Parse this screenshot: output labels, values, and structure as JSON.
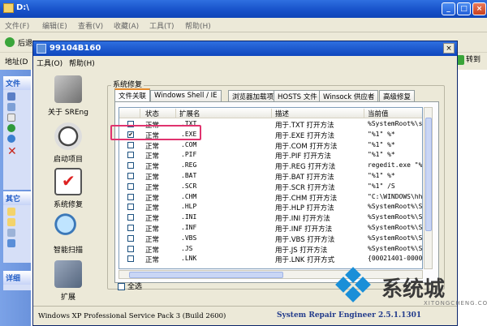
{
  "explorer": {
    "title": "D:\\",
    "menu": [
      "文件(F)",
      "编辑(E)",
      "查看(V)",
      "收藏(A)",
      "工具(T)",
      "帮助(H)"
    ],
    "back_label": "后退",
    "address_label": "地址(D",
    "go_label": "转到",
    "left_panel_headers": [
      "文件",
      "其它",
      "详细"
    ]
  },
  "dialog": {
    "title": "99104B160",
    "close": "×",
    "menu": [
      "工具(O)",
      "帮助(H)"
    ],
    "nav": [
      {
        "label": "关于 SREng",
        "icon": "tools-icon"
      },
      {
        "label": "启动项目",
        "icon": "clock-icon"
      },
      {
        "label": "系统修复",
        "icon": "checklist-icon"
      },
      {
        "label": "智能扫描",
        "icon": "magnifier-icon"
      },
      {
        "label": "扩展",
        "icon": "puzzle-plus-icon"
      }
    ],
    "group_label": "系统修复",
    "tabs": [
      "文件关联",
      "Windows Shell / IE",
      "浏览器加载项",
      "HOSTS 文件",
      "Winsock 供应者",
      "高级修复"
    ],
    "active_tab": 0,
    "columns": [
      "状态",
      "扩展名",
      "描述",
      "当前值"
    ],
    "rows": [
      {
        "checked": false,
        "status": "正常",
        "ext": ".TXT",
        "desc": "用于.TXT 打开方法",
        "value": "%SystemRoot%\\system32\\"
      },
      {
        "checked": true,
        "status": "正常",
        "ext": ".EXE",
        "desc": "用于.EXE 打开方法",
        "value": "\"%1\" %*"
      },
      {
        "checked": false,
        "status": "正常",
        "ext": ".COM",
        "desc": "用于.COM 打开方法",
        "value": "\"%1\" %*"
      },
      {
        "checked": false,
        "status": "正常",
        "ext": ".PIF",
        "desc": "用于.PIF 打开方法",
        "value": "\"%1\" %*"
      },
      {
        "checked": false,
        "status": "正常",
        "ext": ".REG",
        "desc": "用于.REG 打开方法",
        "value": "regedit.exe \"%1\""
      },
      {
        "checked": false,
        "status": "正常",
        "ext": ".BAT",
        "desc": "用于.BAT 打开方法",
        "value": "\"%1\" %*"
      },
      {
        "checked": false,
        "status": "正常",
        "ext": ".SCR",
        "desc": "用于.SCR 打开方法",
        "value": "\"%1\" /S"
      },
      {
        "checked": false,
        "status": "正常",
        "ext": ".CHM",
        "desc": "用于.CHM 打开方法",
        "value": "\"C:\\WINDOWS\\hh.exe\" %1"
      },
      {
        "checked": false,
        "status": "正常",
        "ext": ".HLP",
        "desc": "用于.HLP 打开方法",
        "value": "%SystemRoot%\\System32\\"
      },
      {
        "checked": false,
        "status": "正常",
        "ext": ".INI",
        "desc": "用于.INI 打开方法",
        "value": "%SystemRoot%\\System32\\"
      },
      {
        "checked": false,
        "status": "正常",
        "ext": ".INF",
        "desc": "用于.INF 打开方法",
        "value": "%SystemRoot%\\System32\\"
      },
      {
        "checked": false,
        "status": "正常",
        "ext": ".VBS",
        "desc": "用于.VBS 打开方法",
        "value": "%SystemRoot%\\System32\\"
      },
      {
        "checked": false,
        "status": "正常",
        "ext": ".JS",
        "desc": "用于.JS 打开方法",
        "value": "%SystemRoot%\\System32\\"
      },
      {
        "checked": false,
        "status": "正常",
        "ext": ".LNK",
        "desc": "用于.LNK 打开方式",
        "value": "{00021401-0000-0000-C0"
      }
    ],
    "select_all": "全选",
    "status_os": "Windows XP Professional Service Pack 3 (Build 2600)",
    "status_app": "System Repair Engineer 2.5.1.1301"
  },
  "watermark": {
    "brand": "系统城",
    "url": "XITONGCHENG.COM"
  },
  "colors": {
    "xp_title_blue": "#1650c8",
    "highlight_pink": "#e0336e",
    "tab_accent": "#e68b2c"
  }
}
